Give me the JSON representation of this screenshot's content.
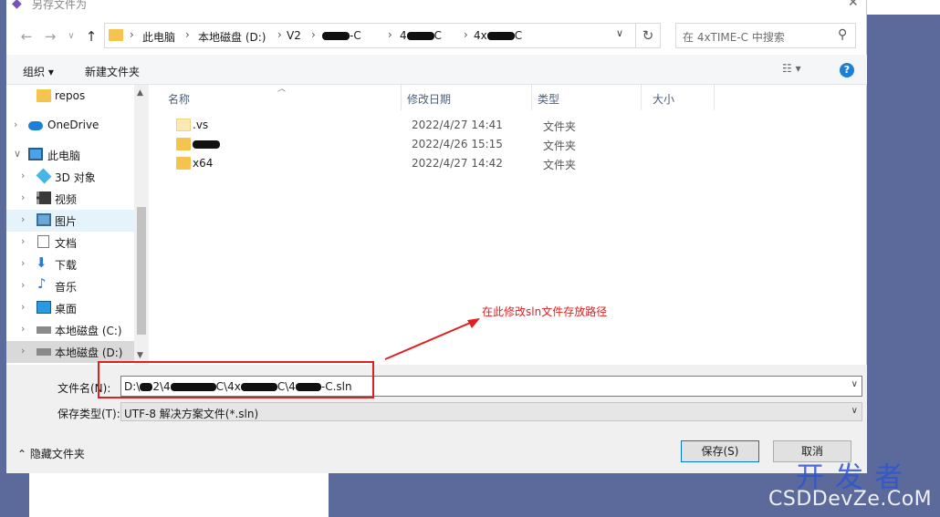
{
  "dialog": {
    "title": "另存文件为"
  },
  "address": {
    "crumbs": [
      "此电脑",
      "本地磁盘 (D:)",
      "V2",
      "4xTIME-C",
      "4xTIME-C",
      "4xTIME-C"
    ],
    "search_placeholder": "在 4xTIME-C 中搜索"
  },
  "toolbar": {
    "organize": "组织 ▾",
    "new_folder": "新建文件夹"
  },
  "nav": {
    "items": [
      {
        "label": "repos",
        "icon": "folder-icon"
      },
      {
        "label": "OneDrive",
        "icon": "cloud-icon"
      },
      {
        "label": "此电脑",
        "icon": "pc-icon"
      },
      {
        "label": "3D 对象",
        "icon": "cube-icon"
      },
      {
        "label": "视频",
        "icon": "video-icon"
      },
      {
        "label": "图片",
        "icon": "picture-icon"
      },
      {
        "label": "文档",
        "icon": "document-icon"
      },
      {
        "label": "下载",
        "icon": "download-icon"
      },
      {
        "label": "音乐",
        "icon": "music-icon"
      },
      {
        "label": "桌面",
        "icon": "desktop-icon"
      },
      {
        "label": "本地磁盘 (C:)",
        "icon": "drive-icon"
      },
      {
        "label": "本地磁盘 (D:)",
        "icon": "drive-icon"
      }
    ]
  },
  "columns": {
    "name": "名称",
    "date": "修改日期",
    "type": "类型",
    "size": "大小"
  },
  "files": [
    {
      "name": ".vs",
      "date": "2022/4/27 14:41",
      "type": "文件夹"
    },
    {
      "name": "",
      "date": "2022/4/26 15:15",
      "type": "文件夹"
    },
    {
      "name": "x64",
      "date": "2022/4/27 14:42",
      "type": "文件夹"
    }
  ],
  "annotation": {
    "text": "在此修改sln文件存放路径"
  },
  "form": {
    "filename_label": "文件名(N):",
    "filename_value": "D:\\V2\\4xTIME-C\\4xTIME-C\\4xTIME-C.sln",
    "filetype_label": "保存类型(T):",
    "filetype_value": "UTF-8 解决方案文件(*.sln)",
    "hide_folders": "隐藏文件夹",
    "save_button": "保存(S)",
    "cancel_button": "取消"
  },
  "watermark": {
    "cn": "开发者",
    "en": "CSDDevZe.CoM"
  },
  "colors": {
    "accent": "#0078d7",
    "annotation_red": "#e02020",
    "folder": "#f5c44e",
    "background": "#5b6a9a"
  }
}
